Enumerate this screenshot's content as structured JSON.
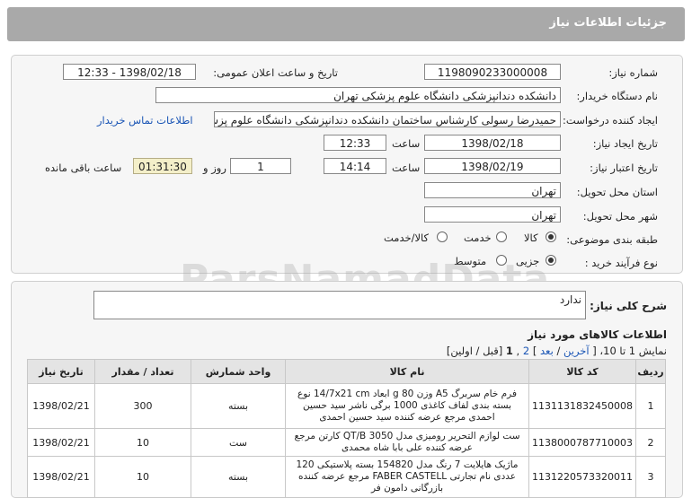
{
  "header": {
    "title": "جزئیات اطلاعات نیاز"
  },
  "form": {
    "need_number_label": "شماره نیاز:",
    "need_number": "1198090233000008",
    "announce_label": "تاریخ و ساعت اعلان عمومی:",
    "announce_value": "1398/02/18 - 12:33",
    "buyer_label": "نام دستگاه خریدار:",
    "buyer_value": "دانشکده دندانپزشکی دانشگاه علوم پزشکی تهران",
    "creator_label": "ایجاد کننده درخواست:",
    "creator_value": "حمیدرضا رسولی کارشناس ساختمان دانشکده دندانپزشکی دانشگاه علوم پزشکی تهران",
    "contact_link": "اطلاعات تماس خریدار",
    "created_date_label": "تاریخ ایجاد نیاز:",
    "created_date": "1398/02/18",
    "time_label": "ساعت",
    "created_time": "12:33",
    "validity_label": "تاریخ اعتبار نیاز:",
    "validity_date": "1398/02/19",
    "validity_time": "14:14",
    "days_value": "1",
    "days_label": "روز و",
    "remaining_time": "01:31:30",
    "remaining_label": "ساعت باقی مانده",
    "province_label": "استان محل تحویل:",
    "province_value": "تهران",
    "city_label": "شهر محل تحویل:",
    "city_value": "تهران",
    "category_label": "طبقه بندی موضوعی:",
    "category_options": [
      "کالا",
      "خدمت",
      "کالا/خدمت"
    ],
    "category_selected": "کالا",
    "process_label": "نوع فرآیند خرید :",
    "process_options": [
      "جزیی",
      "متوسط"
    ],
    "process_selected": "جزیی"
  },
  "watermark": "ParsNamadData",
  "summary": {
    "label": "شرح کلی نیاز:",
    "value": "ندارد"
  },
  "items": {
    "title": "اطلاعات کالاهای مورد نیاز",
    "pagination": {
      "prefix": "نمایش 1 تا 10،",
      "last": "آخرین",
      "next": "بعد",
      "page2": "2",
      "page1": "1",
      "rest": "[قبل / اولین]"
    },
    "columns": [
      "ردیف",
      "کد کالا",
      "نام کالا",
      "واحد شمارش",
      "تعداد / مقدار",
      "تاریخ نیاز"
    ],
    "rows": [
      {
        "row": "1",
        "code": "1131131832450008",
        "name": "فرم خام سربرگ A5 وزن 80 g ابعاد 14/7x21 cm نوع بسته بندی لفاف کاغذی 1000 برگی ناشر سید حسین احمدی مرجع عرضه کننده سید حسین احمدی",
        "unit": "بسته",
        "qty": "300",
        "date": "1398/02/21"
      },
      {
        "row": "2",
        "code": "1138000787710003",
        "name": "ست لوازم التحریر رومیزی مدل QT/B 3050 کارتن مرجع عرضه کننده علی بابا شاه محمدی",
        "unit": "ست",
        "qty": "10",
        "date": "1398/02/21"
      },
      {
        "row": "3",
        "code": "1131220573320011",
        "name": "ماژیک هایلایت 7 رنگ مدل 154820 بسته پلاستیکی 120 عددی نام تجارتی FABER CASTELL مرجع عرضه کننده بازرگانی دامون فر",
        "unit": "بسته",
        "qty": "10",
        "date": "1398/02/21"
      }
    ]
  }
}
